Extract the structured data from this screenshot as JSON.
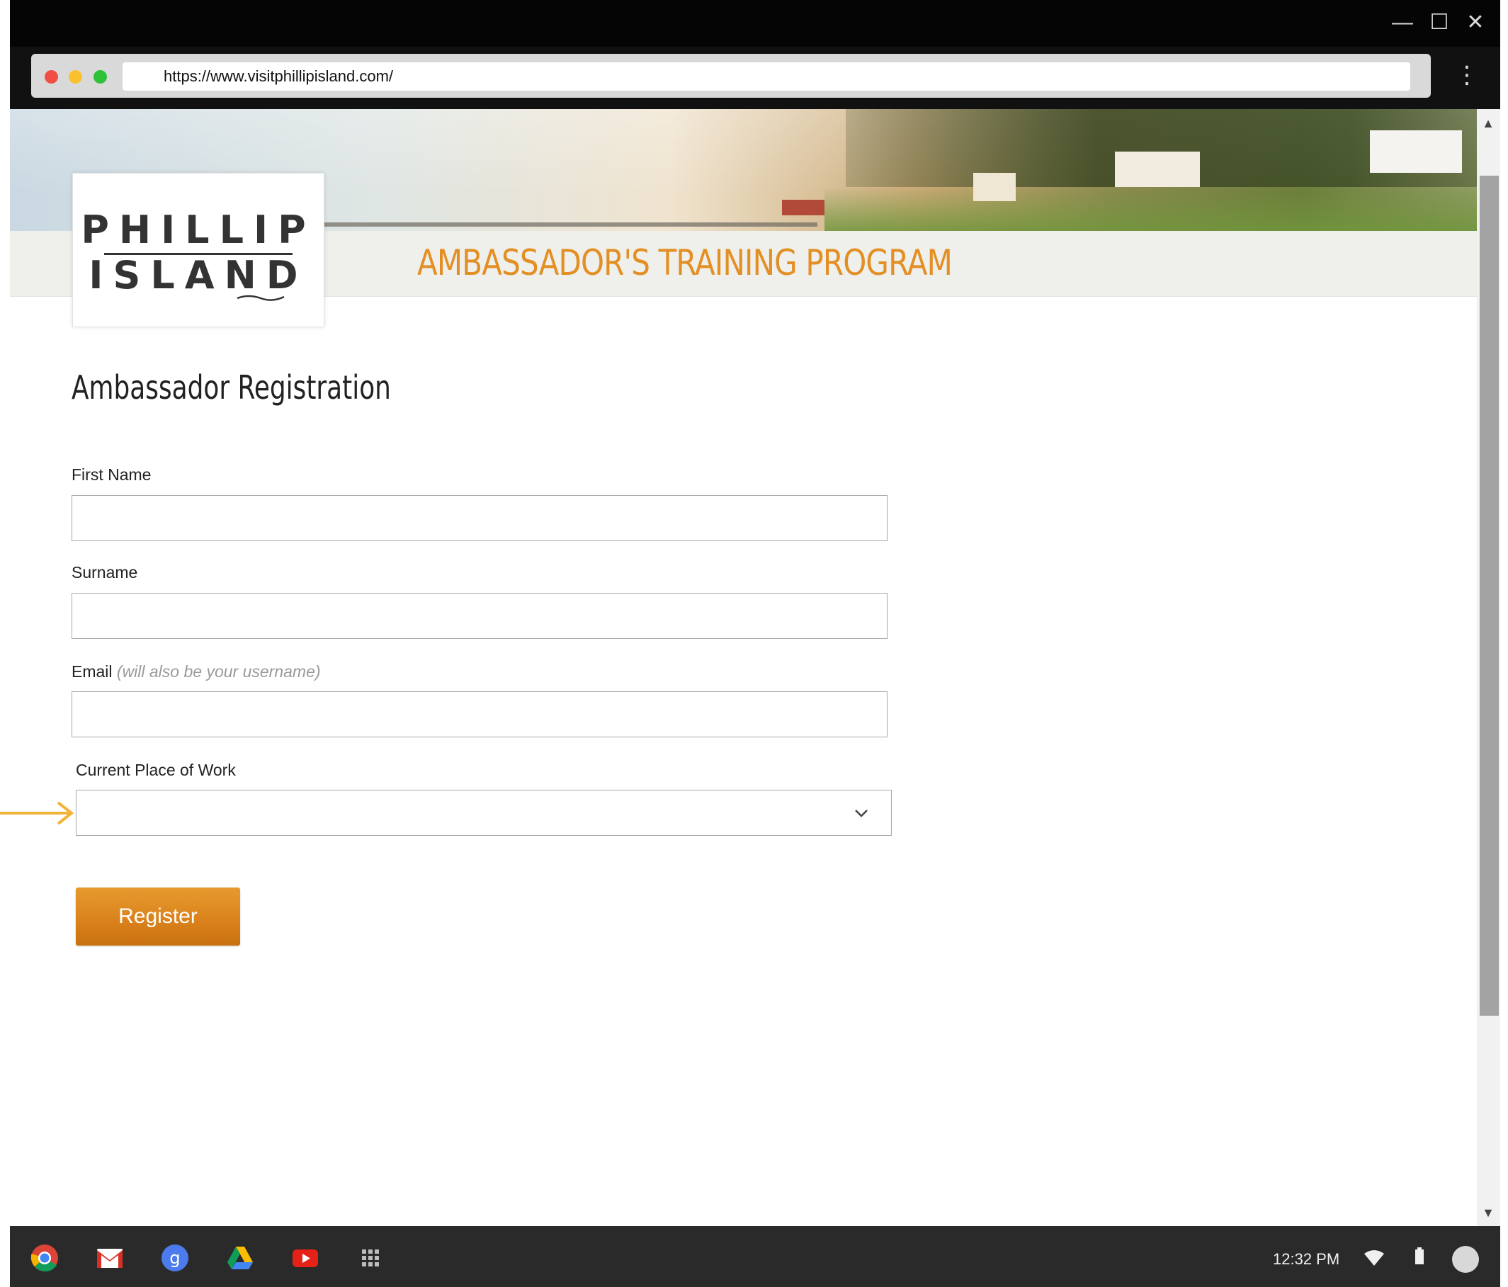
{
  "browser": {
    "url": "https://www.visitphillipisland.com/",
    "controls": {
      "minimize": "—",
      "maximize": "☐",
      "close": "✕"
    },
    "traffic_light_colors": [
      "#f24f44",
      "#fbc02d",
      "#2ec13a"
    ]
  },
  "header": {
    "logo": {
      "line1": "PHILLIP",
      "line2": "ISLAND"
    },
    "program_title": "AMBASSADOR'S TRAINING PROGRAM",
    "accent_color": "#e38f24"
  },
  "form": {
    "heading": "Ambassador Registration",
    "first_name": {
      "label": "First Name",
      "value": ""
    },
    "surname": {
      "label": "Surname",
      "value": ""
    },
    "email": {
      "label": "Email",
      "hint": "(will also be your username)",
      "value": ""
    },
    "place_of_work": {
      "label": "Current Place of Work",
      "selected": ""
    },
    "register_label": "Register"
  },
  "taskbar": {
    "apps": [
      "chrome-icon",
      "gmail-icon",
      "google-plus-icon",
      "drive-icon",
      "youtube-icon",
      "app-launcher-icon"
    ],
    "time": "12:32 PM"
  },
  "annotation_arrow_color": "#f1b43a"
}
